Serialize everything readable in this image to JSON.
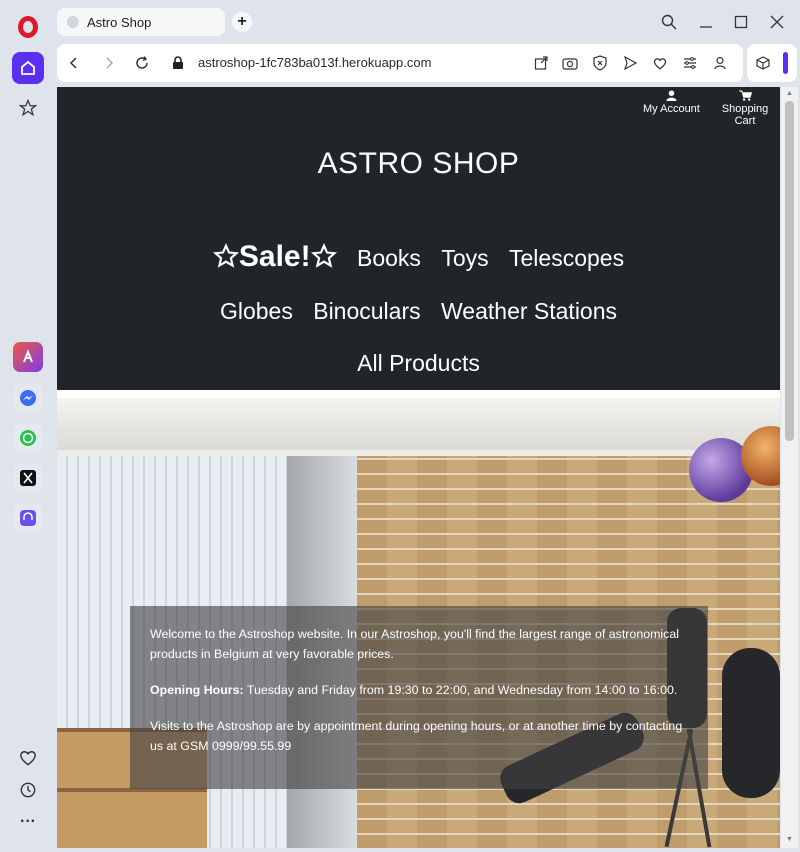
{
  "browser": {
    "tab_title": "Astro Shop",
    "new_tab_label": "+",
    "url": "astroshop-1fc783ba013f.herokuapp.com"
  },
  "sidebar": {
    "items": [
      {
        "name": "opera-logo-icon"
      },
      {
        "name": "home-icon"
      },
      {
        "name": "star-icon"
      },
      {
        "name": "aria-icon"
      },
      {
        "name": "messenger-icon"
      },
      {
        "name": "whatsapp-icon"
      },
      {
        "name": "x-icon"
      },
      {
        "name": "music-icon"
      },
      {
        "name": "heart-icon"
      },
      {
        "name": "history-icon"
      },
      {
        "name": "more-icon"
      }
    ]
  },
  "header": {
    "my_account": "My Account",
    "shopping_cart": "Shopping Cart",
    "site_title": "ASTRO SHOP"
  },
  "nav": {
    "sale": "Sale!",
    "books": "Books",
    "toys": "Toys",
    "telescopes": "Telescopes",
    "globes": "Globes",
    "binoculars": "Binoculars",
    "weather_stations": "Weather Stations",
    "all_products": "All Products"
  },
  "hero": {
    "intro": "Welcome to the Astroshop website. In our Astroshop, you'll find the largest range of astronomical products in Belgium at very favorable prices.",
    "hours_label": "Opening Hours:",
    "hours_text": " Tuesday and Friday from 19:30 to 22:00, and Wednesday from 14:00 to 16:00.",
    "visits": "Visits to the Astroshop are by appointment during opening hours, or at another time by contacting us at GSM 0999/99.55.99"
  },
  "colors": {
    "header_bg": "#212429",
    "opera_accent": "#5b2ff0",
    "opera_red": "#e0162b"
  }
}
